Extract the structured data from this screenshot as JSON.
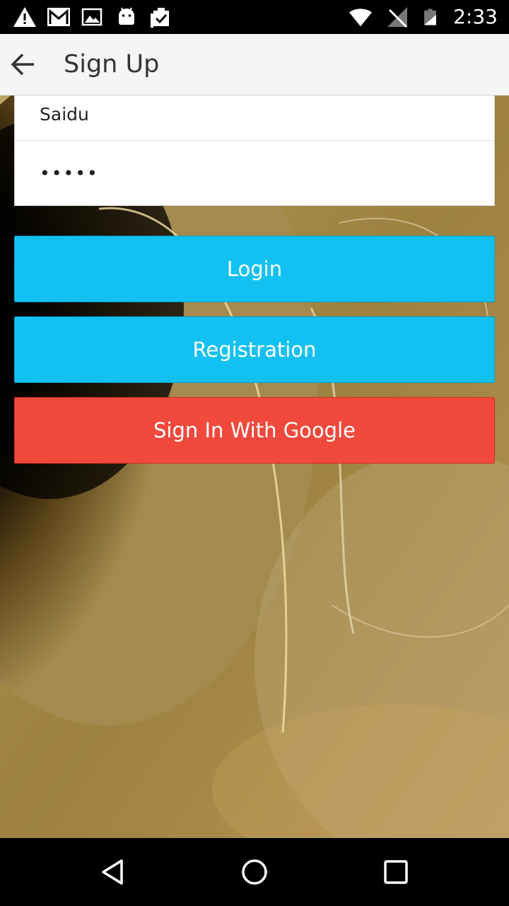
{
  "status_bar": {
    "time": "2:33",
    "left_icons": [
      "warning-icon",
      "gmail-icon",
      "gallery-icon",
      "android-icon",
      "clipboard-check-icon"
    ],
    "right_icons": [
      "wifi-icon",
      "no-signal-icon",
      "battery-icon"
    ]
  },
  "app_bar": {
    "title": "Sign Up",
    "back_icon": "arrow-back-icon"
  },
  "form": {
    "name_value": "Saidu",
    "password_value": "•••••"
  },
  "buttons": {
    "login": "Login",
    "registration": "Registration",
    "google": "Sign In With Google"
  },
  "colors": {
    "app_bar_bg": "#f5f5f5",
    "primary_button": "#12c1f1",
    "google_button": "#f1493c"
  },
  "nav_bar": {
    "icons": [
      "nav-back-icon",
      "nav-home-icon",
      "nav-recents-icon"
    ]
  }
}
